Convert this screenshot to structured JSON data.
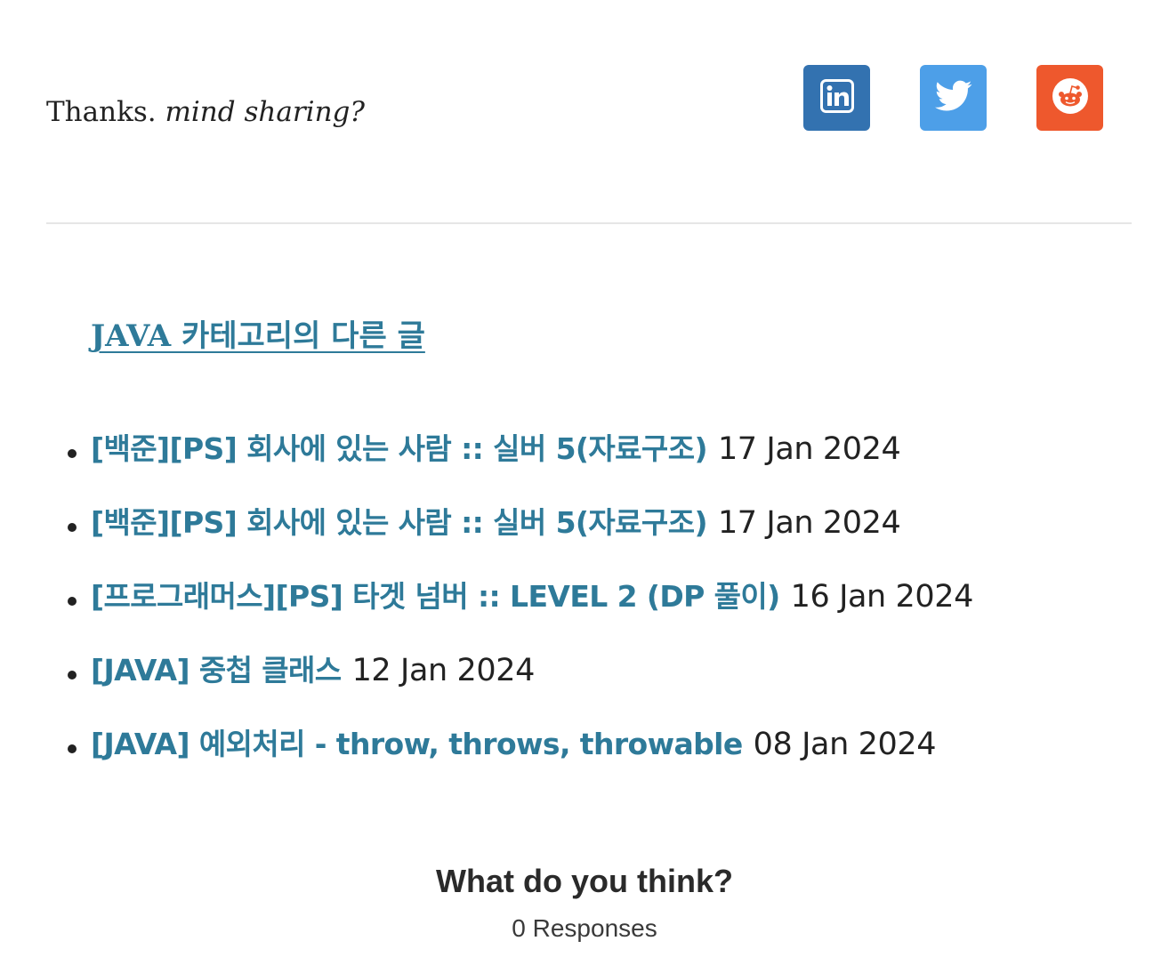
{
  "share": {
    "text_plain": "Thanks.",
    "text_italic": "mind sharing?",
    "buttons": [
      {
        "name": "linkedin",
        "icon": "linkedin-icon",
        "color": "#3372b0"
      },
      {
        "name": "twitter",
        "icon": "twitter-icon",
        "color": "#4d9fe8"
      },
      {
        "name": "reddit",
        "icon": "reddit-icon",
        "color": "#ee582d"
      }
    ]
  },
  "related": {
    "title": "JAVA 카테고리의 다른 글",
    "accent_color": "#2e7a99",
    "posts": [
      {
        "title": "[백준][PS] 회사에 있는 사람 :: 실버 5(자료구조)",
        "date": "17 Jan 2024"
      },
      {
        "title": "[백준][PS] 회사에 있는 사람 :: 실버 5(자료구조)",
        "date": "17 Jan 2024"
      },
      {
        "title": "[프로그래머스][PS] 타겟 넘버 :: LEVEL 2 (DP 풀이)",
        "date": "16 Jan 2024"
      },
      {
        "title": "[JAVA] 중첩 클래스",
        "date": "12 Jan 2024"
      },
      {
        "title": "[JAVA] 예외처리 - throw, throws, throwable",
        "date": "08 Jan 2024"
      }
    ]
  },
  "comments": {
    "heading": "What do you think?",
    "count": "0 Responses"
  }
}
